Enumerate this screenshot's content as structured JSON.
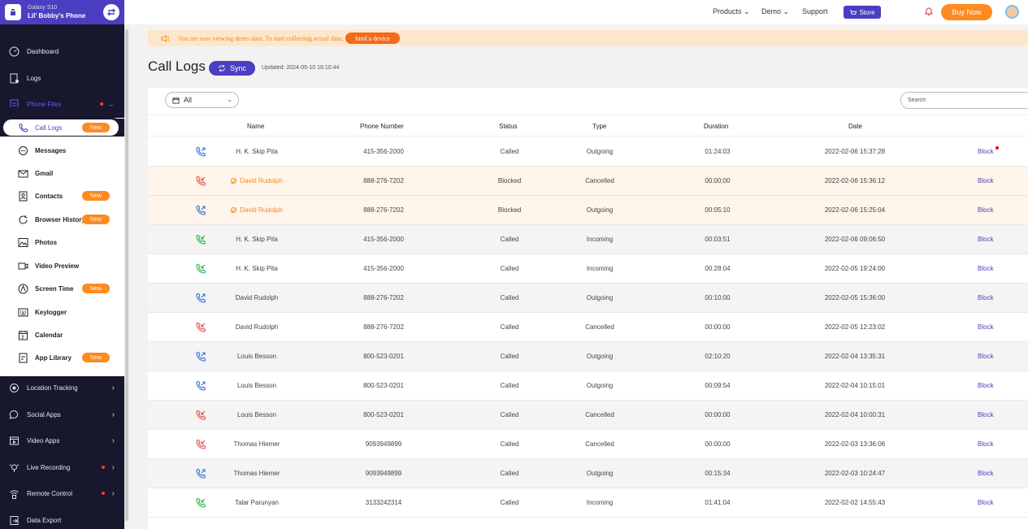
{
  "device": {
    "model": "Galaxy S10",
    "name": "Lil' Bobby's Phone"
  },
  "topnav": {
    "products": "Products",
    "demo": "Demo",
    "support": "Support",
    "store": "Store",
    "buy_now": "Buy Now"
  },
  "sidebar": {
    "dashboard": "Dashboard",
    "logs": "Logs",
    "phone_files": "Phone Files",
    "sub_items": [
      {
        "label": "Call Logs",
        "badge": "New"
      },
      {
        "label": "Messages",
        "badge": ""
      },
      {
        "label": "Gmail",
        "badge": ""
      },
      {
        "label": "Contacts",
        "badge": "New"
      },
      {
        "label": "Browser History",
        "badge": "New"
      },
      {
        "label": "Photos",
        "badge": ""
      },
      {
        "label": "Video Preview",
        "badge": ""
      },
      {
        "label": "Screen Time",
        "badge": "New"
      },
      {
        "label": "Keylogger",
        "badge": ""
      },
      {
        "label": "Calendar",
        "badge": ""
      },
      {
        "label": "App Library",
        "badge": "New"
      }
    ],
    "location_tracking": "Location Tracking",
    "social_apps": "Social Apps",
    "video_apps": "Video Apps",
    "live_recording": "Live Recording",
    "remote_control": "Remote Control",
    "data_export": "Data Export"
  },
  "banner": {
    "text": "You are now viewing demo data. To start collecting actual data,",
    "button": "bind a device"
  },
  "page": {
    "title": "Call Logs",
    "sync": "Sync",
    "updated": "Updated: 2024-05-10 18:10:44"
  },
  "filter": {
    "value": "All"
  },
  "search": {
    "placeholder": "Search"
  },
  "table": {
    "headers": {
      "name": "Name",
      "phone": "Phone Number",
      "status": "Status",
      "type": "Type",
      "duration": "Duration",
      "date": "Date"
    },
    "rows": [
      {
        "name": "H. K. Skip Pita",
        "phone": "415-356-2000",
        "status": "Called",
        "type": "Outgoing",
        "duration": "01:24:03",
        "date": "2022-02-06 15:37:28",
        "action": "Block",
        "direction": "outgoing",
        "blocked": false
      },
      {
        "name": "David Rudolph",
        "phone": "888-276-7202",
        "status": "Blocked",
        "type": "Cancelled",
        "duration": "00:00:00",
        "date": "2022-02-06 15:36:12",
        "action": "Block",
        "direction": "cancelled",
        "blocked": true
      },
      {
        "name": "David Rudolph",
        "phone": "888-276-7202",
        "status": "Blocked",
        "type": "Outgoing",
        "duration": "00:05:10",
        "date": "2022-02-06 15:25:04",
        "action": "Block",
        "direction": "outgoing",
        "blocked": true
      },
      {
        "name": "H. K. Skip Pita",
        "phone": "415-356-2000",
        "status": "Called",
        "type": "Incoming",
        "duration": "00:03:51",
        "date": "2022-02-06 09:06:50",
        "action": "Block",
        "direction": "incoming",
        "blocked": false
      },
      {
        "name": "H. K. Skip Pita",
        "phone": "415-356-2000",
        "status": "Called",
        "type": "Incoming",
        "duration": "00:28:04",
        "date": "2022-02-05 19:24:00",
        "action": "Block",
        "direction": "incoming",
        "blocked": false
      },
      {
        "name": "David Rudolph",
        "phone": "888-276-7202",
        "status": "Called",
        "type": "Outgoing",
        "duration": "00:10:00",
        "date": "2022-02-05 15:36:00",
        "action": "Block",
        "direction": "outgoing",
        "blocked": false
      },
      {
        "name": "David Rudolph",
        "phone": "888-276-7202",
        "status": "Called",
        "type": "Cancelled",
        "duration": "00:00:00",
        "date": "2022-02-05 12:23:02",
        "action": "Block",
        "direction": "cancelled",
        "blocked": false
      },
      {
        "name": "Louis Besson",
        "phone": "800-523-0201",
        "status": "Called",
        "type": "Outgoing",
        "duration": "02:10:20",
        "date": "2022-02-04 13:35:31",
        "action": "Block",
        "direction": "outgoing",
        "blocked": false
      },
      {
        "name": "Louis Besson",
        "phone": "800-523-0201",
        "status": "Called",
        "type": "Outgoing",
        "duration": "00:09:54",
        "date": "2022-02-04 10:15:01",
        "action": "Block",
        "direction": "outgoing",
        "blocked": false
      },
      {
        "name": "Louis Besson",
        "phone": "800-523-0201",
        "status": "Called",
        "type": "Cancelled",
        "duration": "00:00:00",
        "date": "2022-02-04 10:00:31",
        "action": "Block",
        "direction": "cancelled",
        "blocked": false
      },
      {
        "name": "Thomas Hiemer",
        "phone": "9093949899",
        "status": "Called",
        "type": "Cancelled",
        "duration": "00:00:00",
        "date": "2022-02-03 13:36:06",
        "action": "Block",
        "direction": "cancelled",
        "blocked": false
      },
      {
        "name": "Thomas Hiemer",
        "phone": "9093949899",
        "status": "Called",
        "type": "Outgoing",
        "duration": "00:15:34",
        "date": "2022-02-03 10:24:47",
        "action": "Block",
        "direction": "outgoing",
        "blocked": false
      },
      {
        "name": "Talar Parunyan",
        "phone": "3133242314",
        "status": "Called",
        "type": "Incoming",
        "duration": "01:41:04",
        "date": "2022-02-02 14:55:43",
        "action": "Block",
        "direction": "incoming",
        "blocked": false
      }
    ]
  },
  "colors": {
    "accent": "#4a3fc0",
    "orange": "#ff8a1f",
    "sidebar": "#17172e",
    "incoming": "#2bb24c",
    "outgoing": "#3a6fe0",
    "cancelled": "#e84c4c"
  }
}
